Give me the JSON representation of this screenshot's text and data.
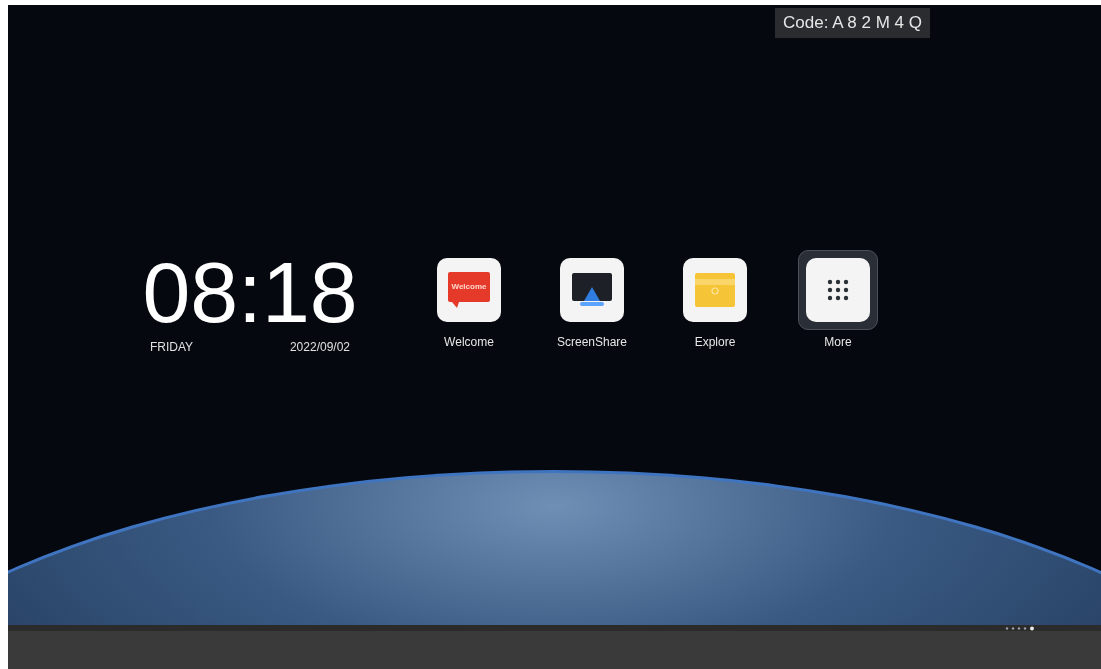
{
  "code_badge": {
    "text": "Code: A 8 2 M 4 Q"
  },
  "clock": {
    "time": "08:18",
    "weekday": "FRIDAY",
    "date": "2022/09/02"
  },
  "apps": [
    {
      "kind": "welcome",
      "label": "Welcome",
      "icon_text": "Welcome",
      "selected": false
    },
    {
      "kind": "screenshare",
      "label": "ScreenShare",
      "selected": false
    },
    {
      "kind": "explore",
      "label": "Explore",
      "selected": false
    },
    {
      "kind": "more",
      "label": "More",
      "selected": true
    }
  ]
}
